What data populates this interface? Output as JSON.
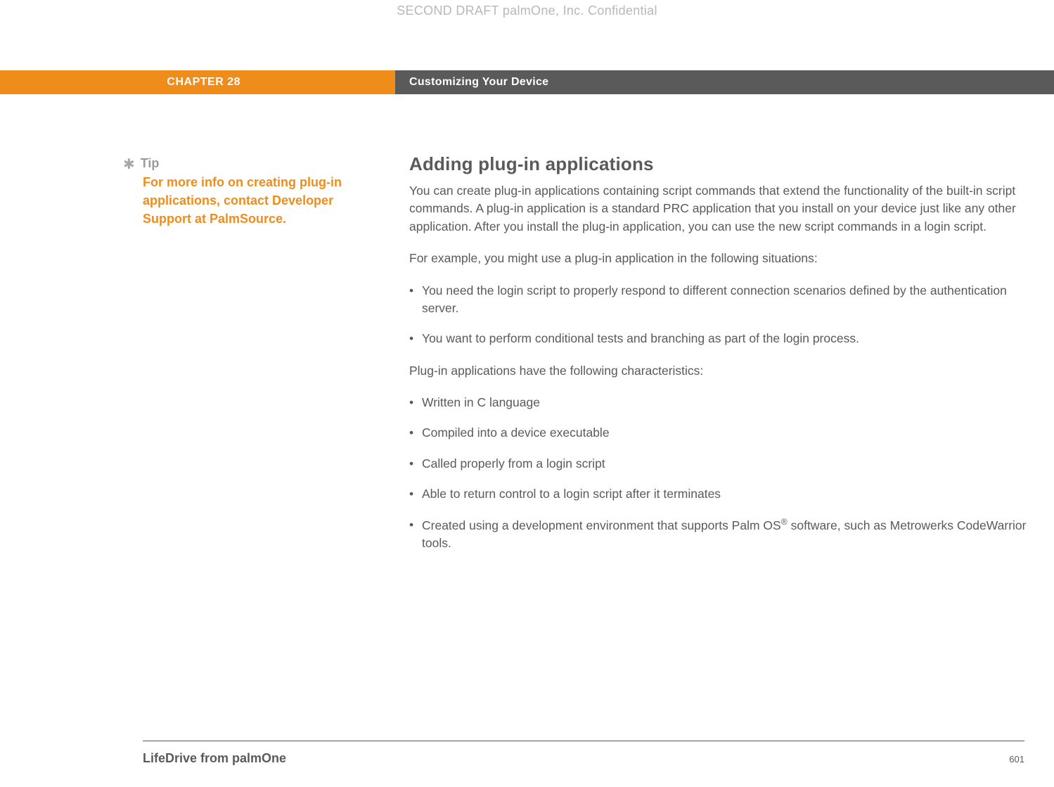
{
  "watermark": "SECOND DRAFT palmOne, Inc.  Confidential",
  "chapter": {
    "label": "CHAPTER 28",
    "title": "Customizing Your Device"
  },
  "tip": {
    "label": "Tip",
    "body": "For more info on creating plug-in applications, contact Developer Support at PalmSource."
  },
  "main": {
    "heading": "Adding plug-in applications",
    "p1": "You can create plug-in applications containing script commands that extend the functionality of the built-in script commands. A plug-in application is a standard PRC application that you install on your device just like any other application. After you install the plug-in application, you can use the new script commands in a login script.",
    "p2": "For example, you might use a plug-in application in the following situations:",
    "situations": [
      "You need the login script to properly respond to different connection scenarios defined by the authentication server.",
      "You want to perform conditional tests and branching as part of the login process."
    ],
    "p3": "Plug-in applications have the following characteristics:",
    "characteristics": [
      "Written in C language",
      "Compiled into a device executable",
      "Called properly from a login script",
      "Able to return control to a login script after it terminates",
      "Created using a development environment that supports Palm OS® software, such as Metrowerks CodeWarrior tools."
    ]
  },
  "footer": {
    "product": "LifeDrive from palmOne",
    "page": "601"
  }
}
